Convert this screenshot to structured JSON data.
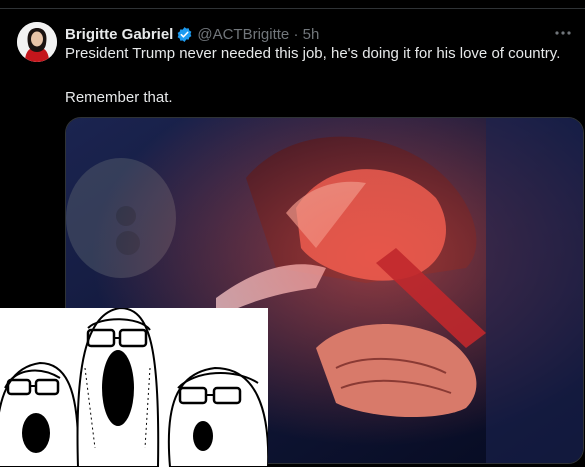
{
  "tweet": {
    "author_name": "Brigitte Gabriel",
    "handle_time": "@ACTBrigitte · 5h",
    "line1": "President Trump never needed this job, he's doing it for his love of country.",
    "line2": "Remember that."
  },
  "icons": {
    "verified": "verified-badge-icon",
    "more": "more-options-icon"
  },
  "colors": {
    "background": "#000000",
    "text": "#e7e9ea",
    "muted": "#71767b",
    "verified": "#1d9bf0"
  }
}
